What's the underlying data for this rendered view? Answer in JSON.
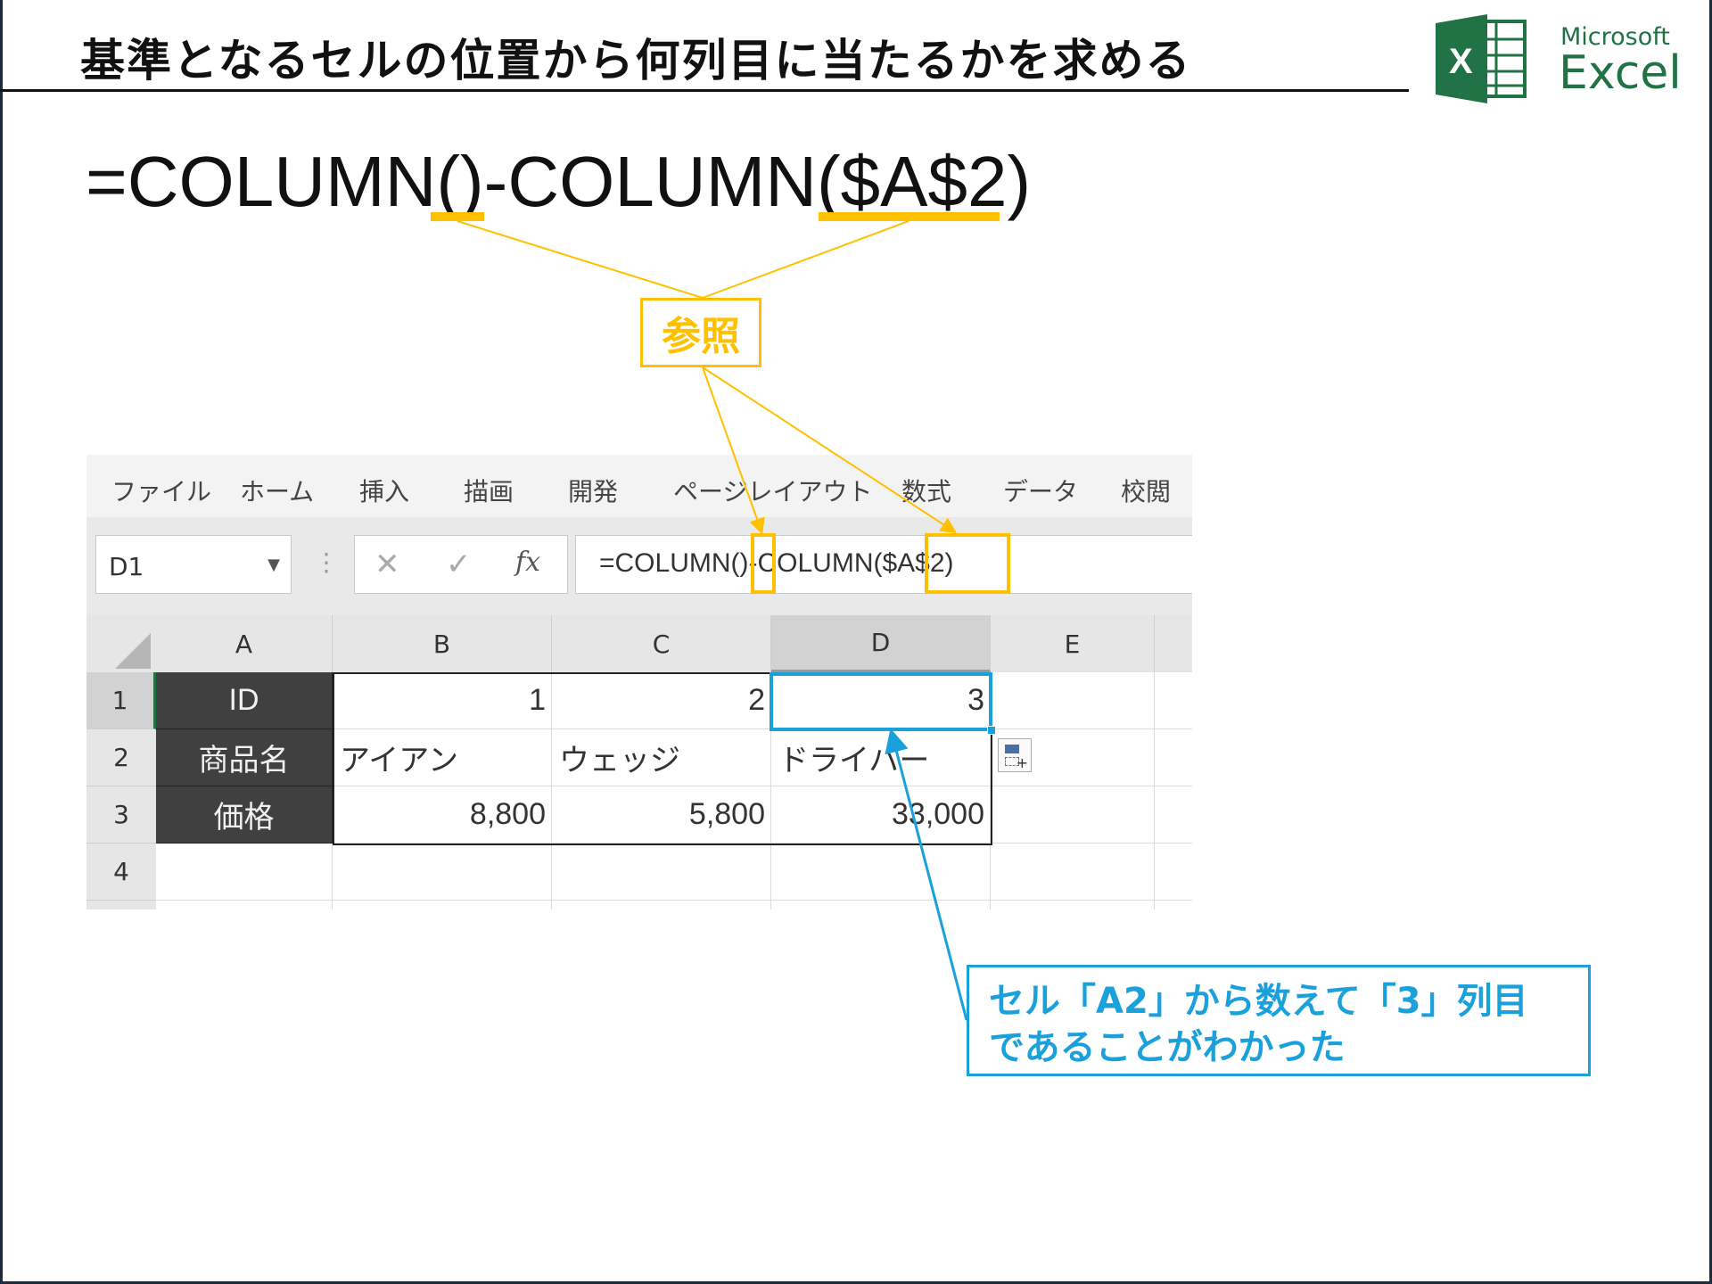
{
  "page": {
    "title": "基準となるセルの位置から何列目に当たるかを求める"
  },
  "logo": {
    "line1": "Microsoft",
    "line2": "Excel",
    "icon_letter": "X",
    "brand_color": "#217346"
  },
  "formula_display": "=COLUMN()-COLUMN($A$2)",
  "callouts": {
    "reference_label": "参照",
    "result_line1": "セル「A2」から数えて「3」列目",
    "result_line2": "であることがわかった",
    "reference_color": "#FFC000",
    "result_color": "#1AA0DB"
  },
  "excel": {
    "ribbon_tabs": [
      "ファイル",
      "ホーム",
      "挿入",
      "描画",
      "開発",
      "ページレイアウト",
      "数式",
      "データ",
      "校閲"
    ],
    "name_box": "D1",
    "formula_bar": "=COLUMN()-COLUMN($A$2)",
    "cancel_glyph": "✕",
    "enter_glyph": "✓",
    "fx_glyph": "fx",
    "columns": [
      "A",
      "B",
      "C",
      "D",
      "E"
    ],
    "rows": [
      "1",
      "2",
      "3",
      "4"
    ],
    "cells": {
      "A1": "ID",
      "B1": "1",
      "C1": "2",
      "D1": "3",
      "A2": "商品名",
      "B2": "アイアン",
      "C2": "ウェッジ",
      "D2": "ドライバー",
      "A3": "価格",
      "B3": "8,800",
      "C3": "5,800",
      "D3": "33,000"
    },
    "selected_cell": "D1"
  }
}
